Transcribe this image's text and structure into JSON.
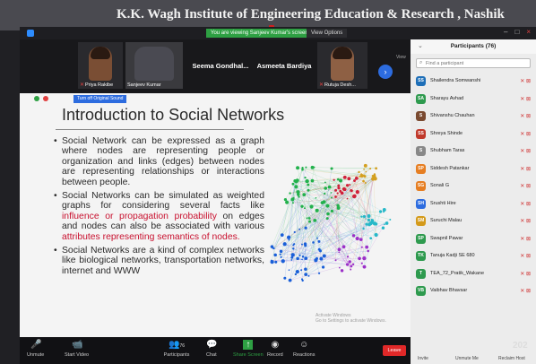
{
  "banner": {
    "title": "K.K. Wagh Institute of Engineering Education & Research , Nashik"
  },
  "titlebar": {
    "viewing_badge": "You are viewing Sanjeev Kumar's screen",
    "view_options": "View Options",
    "minimize": "–",
    "maximize": "□",
    "close": "×"
  },
  "gallery": {
    "tiles": [
      {
        "name": "Priya Rakibe"
      },
      {
        "name": "Sanjeev Kumar"
      },
      {
        "name": "Seema Gondhal..."
      },
      {
        "name": "Asmeeta Bardiya"
      },
      {
        "name": "Rutuja Desh..."
      }
    ],
    "view_label": "View"
  },
  "slide": {
    "stop_share": "Turn off Original Sound",
    "title": "Introduction to Social Networks",
    "bullets": [
      {
        "parts": [
          {
            "text": "Social Network can be expressed as a graph where nodes are representing people or organization and links (edges) between nodes are representing relationships or interactions between people.",
            "red": false
          }
        ]
      },
      {
        "parts": [
          {
            "text": "Social Networks can be simulated as weighted graphs for considering several facts like ",
            "red": false
          },
          {
            "text": "influence or propagation probability",
            "red": true
          },
          {
            "text": " on edges and nodes can also be associated with various ",
            "red": false
          },
          {
            "text": "attributes representing semantics of nodes.",
            "red": true
          }
        ]
      },
      {
        "parts": [
          {
            "text": "Social Networks are a kind of complex networks like biological networks, transportation networks, internet and WWW",
            "red": false
          }
        ]
      }
    ],
    "watermark": "Activate Windows\nGo to Settings to activate Windows."
  },
  "participants": {
    "title": "Participants (76)",
    "search_placeholder": "Find a participant",
    "list": [
      {
        "initials": "SS",
        "name": "Shailendra Somwanshi",
        "color": "#1e6fb8"
      },
      {
        "initials": "SA",
        "name": "Sharayu Avhad",
        "color": "#2e9a4e"
      },
      {
        "initials": "S",
        "name": "Shivanshu Chauhan",
        "color": "#7a4a30"
      },
      {
        "initials": "SS",
        "name": "Shreya Shinde",
        "color": "#c0392b"
      },
      {
        "initials": "S",
        "name": "Shubham Taras",
        "color": "#888888"
      },
      {
        "initials": "SP",
        "name": "Siddesh Patankar",
        "color": "#e67e22"
      },
      {
        "initials": "SG",
        "name": "Sonali G",
        "color": "#e67e22"
      },
      {
        "initials": "SH",
        "name": "Srushti Hire",
        "color": "#2d6cdf"
      },
      {
        "initials": "SM",
        "name": "Suruchi Malau",
        "color": "#d49a1a"
      },
      {
        "initials": "SP",
        "name": "Swapnil Pawar",
        "color": "#2e9a4e"
      },
      {
        "initials": "TK",
        "name": "Tanuja Kadji SE 680",
        "color": "#2e9a4e"
      },
      {
        "initials": "T",
        "name": "TEA_72_Pratik_Wakane",
        "color": "#2e9a4e"
      },
      {
        "initials": "VB",
        "name": "Vaibhav Bhavsar",
        "color": "#2e9a4e"
      }
    ],
    "footer": {
      "invite": "Invite",
      "unmute_me": "Unmute Me",
      "reclaim_host": "Reclaim Host"
    }
  },
  "toolbar": {
    "unmute": "Unmute",
    "start_video": "Start Video",
    "participants": "Participants",
    "participants_count": "76",
    "chat": "Chat",
    "share_screen": "Share Screen",
    "record": "Record",
    "reactions": "Reactions",
    "leave": "Leave"
  },
  "clock": "202",
  "network": {
    "clusters": [
      {
        "color": "#22b14c",
        "label": "green"
      },
      {
        "color": "#1a5fd8",
        "label": "blue"
      },
      {
        "color": "#d0223a",
        "label": "red"
      },
      {
        "color": "#9b30c8",
        "label": "purple"
      },
      {
        "color": "#26b8c8",
        "label": "cyan"
      },
      {
        "color": "#d4a020",
        "label": "gold"
      }
    ]
  }
}
